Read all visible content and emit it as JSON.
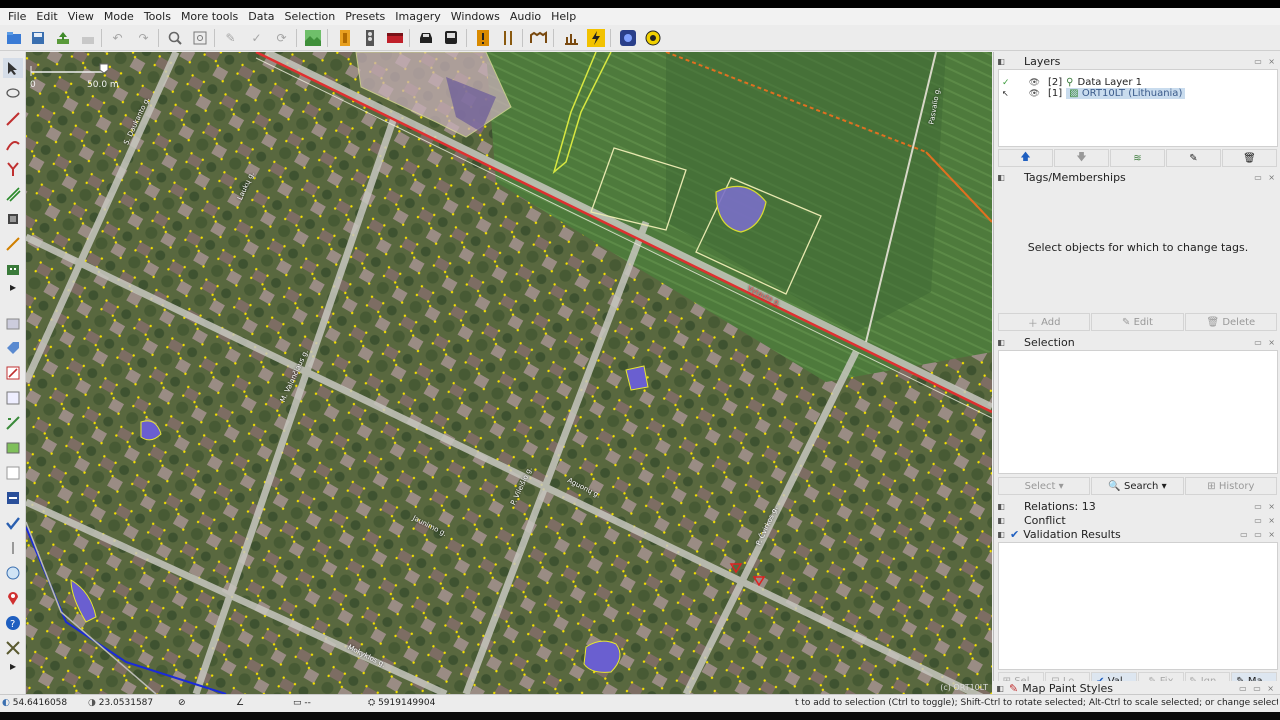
{
  "menu": [
    "File",
    "Edit",
    "View",
    "Mode",
    "Tools",
    "More tools",
    "Data",
    "Selection",
    "Presets",
    "Imagery",
    "Windows",
    "Audio",
    "Help"
  ],
  "toolbar_icons": [
    "open-icon",
    "save-icon",
    "upload-icon",
    "download-icon",
    "undo-icon",
    "redo-icon",
    "zoom-icon",
    "zoom-fit-icon",
    "preset-icon",
    "validate-icon",
    "refresh-icon",
    "imagery-icon",
    "door-icon",
    "traffic-light-icon",
    "flag-icon",
    "car-icon",
    "bus-icon",
    "warning-icon",
    "restaurant-icon",
    "fence-icon",
    "chart-icon",
    "lightning-icon",
    "wms-icon",
    "sun-icon"
  ],
  "map": {
    "scale_zero": "0",
    "scale_label": "50.0 m",
    "streets": [
      "Vytauto g.",
      "M. Valančiaus g.",
      "P. Čvirkos g.",
      "Aguonų g.",
      "Jaunimo g.",
      "Mokyklos g.",
      "S. Daukanto g.",
      "Pasvalio g.",
      "P. Vileišio g.",
      "Laukų g."
    ],
    "attribution": "(c) ORT10LT"
  },
  "layers": {
    "title": "Layers",
    "items": [
      {
        "index": "[2]",
        "name": "Data Layer 1"
      },
      {
        "index": "[1]",
        "name": "ORT10LT (Lithuania)"
      }
    ]
  },
  "tags": {
    "title": "Tags/Memberships",
    "empty": "Select objects for which to change tags.",
    "buttons": [
      "Add",
      "Edit",
      "Delete"
    ]
  },
  "selection": {
    "title": "Selection",
    "buttons": [
      "Select",
      "Search",
      "History"
    ]
  },
  "relations": {
    "title": "Relations: 13"
  },
  "conflict": {
    "title": "Conflict"
  },
  "validation": {
    "title": "Validation Results"
  },
  "dialog_toggles": [
    "Sel...",
    "Lo...",
    "Val...",
    "Fix",
    "Ign...",
    "Ma..."
  ],
  "map_paint": {
    "title": "Map Paint Styles"
  },
  "status": {
    "lat": "54.6416058",
    "lon": "23.0531587",
    "heading": "",
    "angle": "",
    "length": "--",
    "id": "5919149904",
    "help": "t to add to selection (Ctrl to toggle); Shift-Ctrl to rotate selected; Alt-Ctrl to scale selected; or change selection"
  }
}
